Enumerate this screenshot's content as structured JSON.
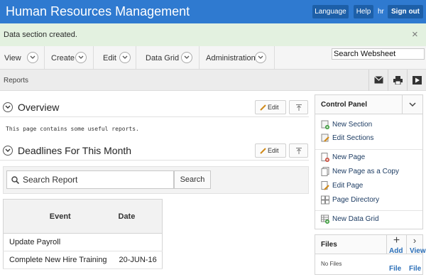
{
  "header": {
    "title": "Human Resources Management",
    "language_label": "Language",
    "help_label": "Help",
    "user": "hr",
    "signout_label": "Sign out"
  },
  "message": {
    "text": "Data section created.",
    "close_glyph": "×"
  },
  "menu": {
    "items": [
      "View",
      "Create",
      "Edit",
      "Data Grid",
      "Administration"
    ],
    "search_value": "Search Websheet"
  },
  "reports": {
    "label": "Reports",
    "icons": [
      "mail-icon",
      "print-icon",
      "play-icon"
    ]
  },
  "overview": {
    "title": "Overview",
    "edit_label": "Edit",
    "text": "This page contains some useful reports."
  },
  "deadlines": {
    "title": "Deadlines For This Month",
    "edit_label": "Edit",
    "search_placeholder": "Search Report",
    "search_button": "Search",
    "columns": [
      "Event",
      "Date"
    ],
    "rows": [
      {
        "event": "Update Payroll",
        "date": ""
      },
      {
        "event": "Complete New Hire Training",
        "date": "20-JUN-16"
      }
    ]
  },
  "control_panel": {
    "title": "Control Panel",
    "links": [
      {
        "label": "New Section",
        "icon": "new-section-icon"
      },
      {
        "label": "Edit Sections",
        "icon": "edit-sections-icon"
      },
      {
        "label": "New Page",
        "icon": "new-page-icon"
      },
      {
        "label": "New Page as a Copy",
        "icon": "page-copy-icon"
      },
      {
        "label": "Edit Page",
        "icon": "edit-page-icon"
      },
      {
        "label": "Page Directory",
        "icon": "page-directory-icon"
      },
      {
        "label": "New Data Grid",
        "icon": "data-grid-icon"
      }
    ]
  },
  "files": {
    "title": "Files",
    "add_glyph": "+",
    "view_glyph": "›",
    "add_label_1": "Add",
    "add_label_2": "File",
    "view_label_1": "View",
    "view_label_2": "File",
    "empty_text": "No Files"
  },
  "colors": {
    "header": "#2f7ad0",
    "header_button": "#1d5fa8",
    "success": "#e3f1e0",
    "link": "#1d3c63"
  }
}
